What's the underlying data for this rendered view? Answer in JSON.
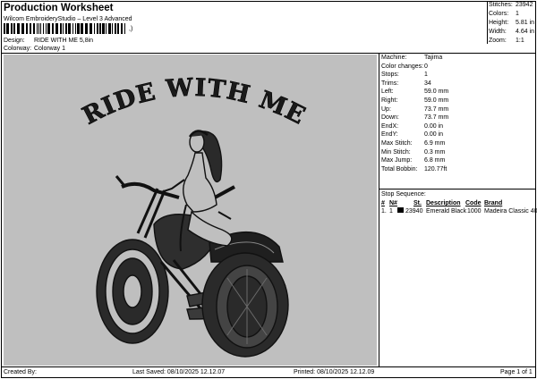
{
  "header": {
    "title": "Production Worksheet",
    "subtitle": "Wilcom EmbroideryStudio – Level 3 Advanced",
    "barcode_mark": ",)",
    "design_label": "Design:",
    "design_value": "RIDE WITH ME 5,8in",
    "colorway_label": "Colorway:",
    "colorway_value": "Colorway 1"
  },
  "summary": [
    {
      "label": "Stitches:",
      "value": "23942"
    },
    {
      "label": "Colors:",
      "value": "1"
    },
    {
      "label": "Height:",
      "value": "5.81 in"
    },
    {
      "label": "Width:",
      "value": "4.64 in"
    },
    {
      "label": "Zoom:",
      "value": "1:1"
    }
  ],
  "design": {
    "lettering": "RIDE WITH ME",
    "thread_color": "#1a1a1a",
    "background_color": "#bfbfbf"
  },
  "params": [
    {
      "label": "Machine:",
      "value": "Tajima"
    },
    {
      "label": "Color changes:",
      "value": "0"
    },
    {
      "label": "Stops:",
      "value": "1"
    },
    {
      "label": "Trims:",
      "value": "34"
    },
    {
      "label": "Left:",
      "value": "59.0 mm"
    },
    {
      "label": "Right:",
      "value": "59.0 mm"
    },
    {
      "label": "Up:",
      "value": "73.7 mm"
    },
    {
      "label": "Down:",
      "value": "73.7 mm"
    },
    {
      "label": "EndX:",
      "value": "0.00 in"
    },
    {
      "label": "EndY:",
      "value": "0.00 in"
    },
    {
      "label": "Max Stitch:",
      "value": "6.9 mm"
    },
    {
      "label": "Min Stitch:",
      "value": "0.3 mm"
    },
    {
      "label": "Max Jump:",
      "value": "6.8 mm"
    },
    {
      "label": "Total Bobbin:",
      "value": "120.77ft"
    }
  ],
  "stop_sequence": {
    "title": "Stop Sequence:",
    "headers": {
      "num": "#",
      "n": "N#",
      "st": "St.",
      "description": "Description",
      "code": "Code",
      "brand": "Brand"
    },
    "rows": [
      {
        "num": "1.",
        "n": "1",
        "st": "23940",
        "description": "Emerald Black",
        "code": "1000",
        "brand": "Madeira Classic 40",
        "color": "#000000"
      }
    ]
  },
  "footer": {
    "created_by": "Created By:",
    "last_saved": "Last Saved: 08/10/2025 12.12.07",
    "printed": "Printed: 08/10/2025 12.12.09",
    "page": "Page 1 of 1"
  }
}
